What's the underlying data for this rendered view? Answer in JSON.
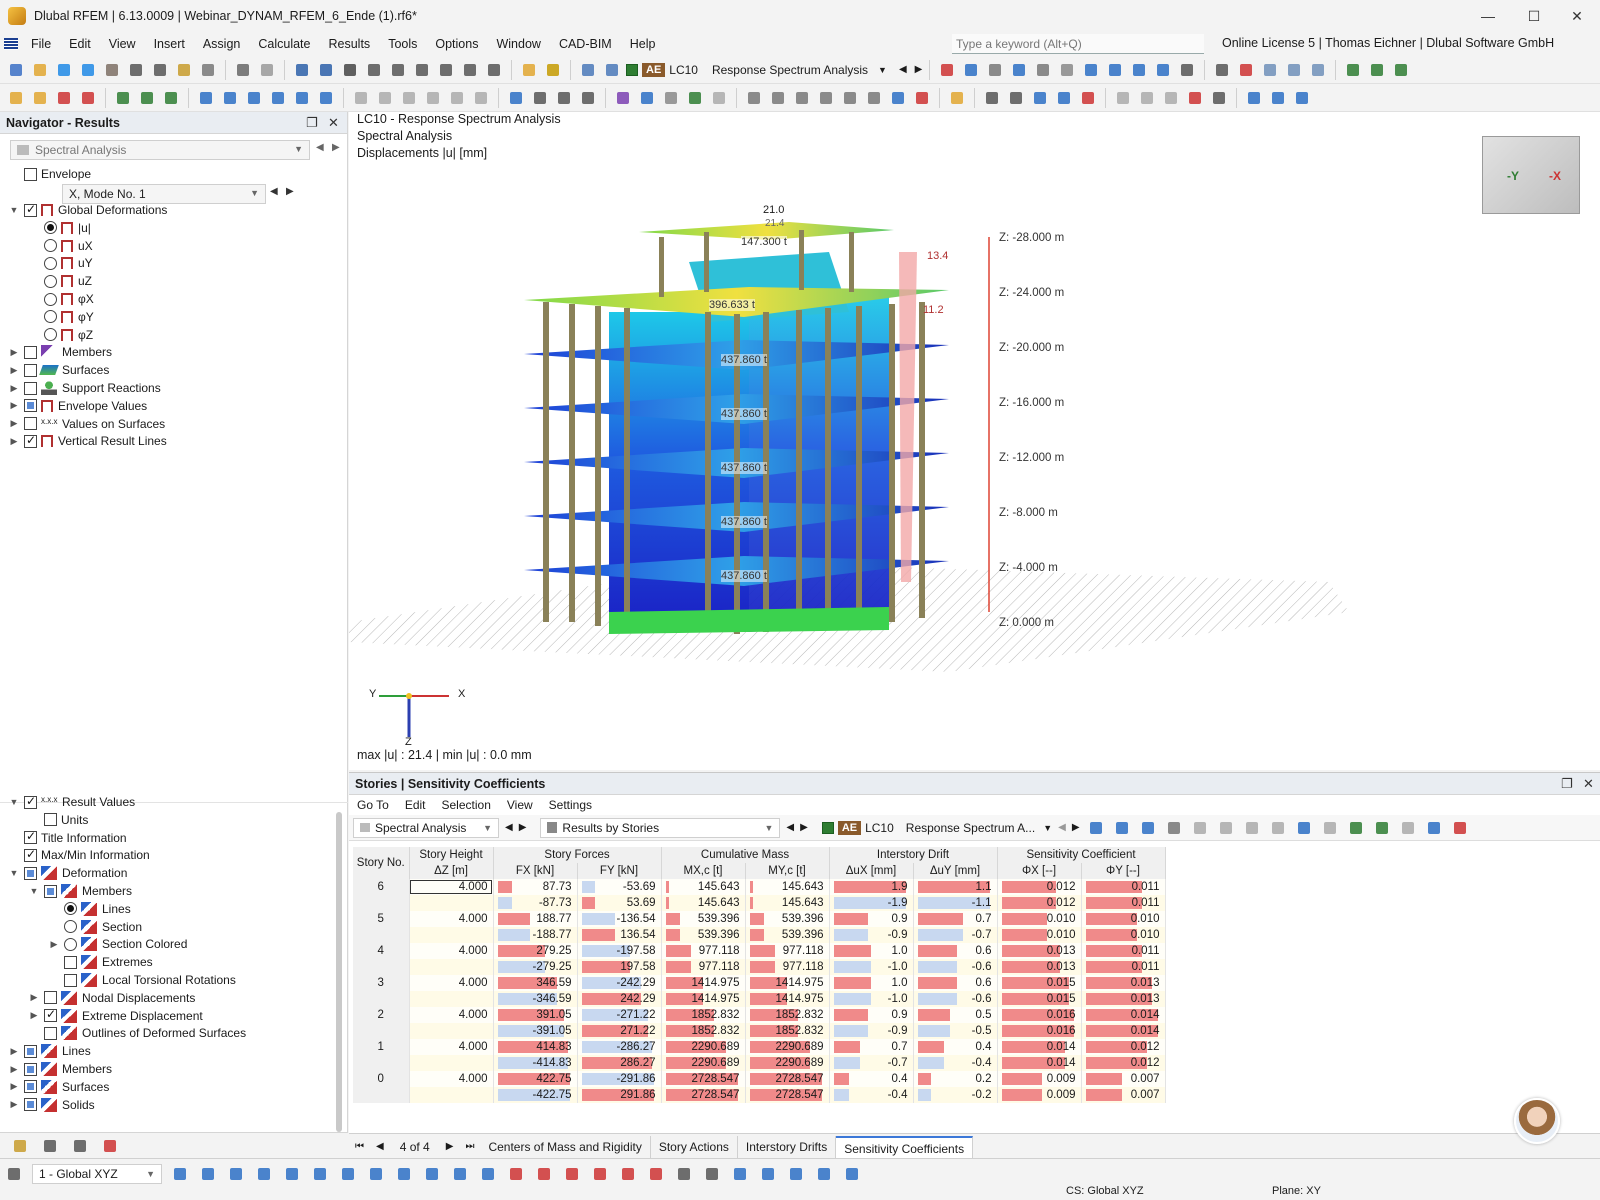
{
  "window": {
    "title": "Dlubal RFEM | 6.13.0009 | Webinar_DYNAM_RFEM_6_Ende (1).rf6*",
    "minimize": "—",
    "maximize": "☐",
    "close": "✕"
  },
  "menu": {
    "items": [
      "File",
      "Edit",
      "View",
      "Insert",
      "Assign",
      "Calculate",
      "Results",
      "Tools",
      "Options",
      "Window",
      "CAD-BIM",
      "Help"
    ],
    "search_placeholder": "Type a keyword (Alt+Q)",
    "license": "Online License 5 | Thomas Eichner | Dlubal Software GmbH"
  },
  "toolbar": {
    "ae": "AE",
    "lc": "LC10",
    "lc_name": "Response Spectrum Analysis"
  },
  "navigator": {
    "title": "Navigator - Results",
    "dropdown": "Spectral Analysis",
    "envelope": "Envelope",
    "mode": "X, Mode No. 1",
    "tree": [
      {
        "label": "Global Deformations",
        "level": 0,
        "exp": "v",
        "ctrl": "chk-on",
        "icon": "defo"
      },
      {
        "label": "|u|",
        "level": 1,
        "ctrl": "radio-on",
        "icon": "defo"
      },
      {
        "label": "uX",
        "level": 1,
        "ctrl": "radio",
        "icon": "defo"
      },
      {
        "label": "uY",
        "level": 1,
        "ctrl": "radio",
        "icon": "defo"
      },
      {
        "label": "uZ",
        "level": 1,
        "ctrl": "radio",
        "icon": "defo"
      },
      {
        "label": "φX",
        "level": 1,
        "ctrl": "radio",
        "icon": "defo"
      },
      {
        "label": "φY",
        "level": 1,
        "ctrl": "radio",
        "icon": "defo"
      },
      {
        "label": "φZ",
        "level": 1,
        "ctrl": "radio",
        "icon": "defo"
      },
      {
        "label": "Members",
        "level": 0,
        "exp": ">",
        "ctrl": "chk",
        "icon": "member"
      },
      {
        "label": "Surfaces",
        "level": 0,
        "exp": ">",
        "ctrl": "chk",
        "icon": "surf"
      },
      {
        "label": "Support Reactions",
        "level": 0,
        "exp": ">",
        "ctrl": "chk",
        "icon": "support"
      },
      {
        "label": "Envelope Values",
        "level": 0,
        "exp": ">",
        "ctrl": "chk-partial",
        "icon": "defo"
      },
      {
        "label": "Values on Surfaces",
        "level": 0,
        "exp": ">",
        "ctrl": "chk",
        "icon": "xxx"
      },
      {
        "label": "Vertical Result Lines",
        "level": 0,
        "exp": ">",
        "ctrl": "chk-on",
        "icon": "defo"
      }
    ],
    "tree2": [
      {
        "label": "Result Values",
        "level": 0,
        "exp": "v",
        "ctrl": "chk-on",
        "icon": "xxx"
      },
      {
        "label": "Units",
        "level": 1,
        "ctrl": "chk",
        "icon": ""
      },
      {
        "label": "Title Information",
        "level": 0,
        "ctrl": "chk-on",
        "icon": ""
      },
      {
        "label": "Max/Min Information",
        "level": 0,
        "ctrl": "chk-on",
        "icon": ""
      },
      {
        "label": "Deformation",
        "level": 0,
        "exp": "v",
        "ctrl": "chk-partial",
        "icon": "blue"
      },
      {
        "label": "Members",
        "level": 1,
        "exp": "v",
        "ctrl": "chk-partial",
        "icon": "blue"
      },
      {
        "label": "Lines",
        "level": 2,
        "ctrl": "radio-on",
        "icon": "blue"
      },
      {
        "label": "Section",
        "level": 2,
        "ctrl": "radio",
        "icon": "blue"
      },
      {
        "label": "Section Colored",
        "level": 2,
        "exp": ">",
        "ctrl": "radio",
        "icon": "blue"
      },
      {
        "label": "Extremes",
        "level": 2,
        "ctrl": "chk",
        "icon": "blue"
      },
      {
        "label": "Local Torsional Rotations",
        "level": 2,
        "ctrl": "chk",
        "icon": "blue"
      },
      {
        "label": "Nodal Displacements",
        "level": 1,
        "exp": ">",
        "ctrl": "chk",
        "icon": "blue"
      },
      {
        "label": "Extreme Displacement",
        "level": 1,
        "exp": ">",
        "ctrl": "chk-on",
        "icon": "blue"
      },
      {
        "label": "Outlines of Deformed Surfaces",
        "level": 1,
        "ctrl": "chk",
        "icon": "blue"
      },
      {
        "label": "Lines",
        "level": 0,
        "exp": ">",
        "ctrl": "chk-partial",
        "icon": "blue"
      },
      {
        "label": "Members",
        "level": 0,
        "exp": ">",
        "ctrl": "chk-partial",
        "icon": "blue"
      },
      {
        "label": "Surfaces",
        "level": 0,
        "exp": ">",
        "ctrl": "chk-partial",
        "icon": "blue"
      },
      {
        "label": "Solids",
        "level": 0,
        "exp": ">",
        "ctrl": "chk-partial",
        "icon": "blue"
      }
    ]
  },
  "viewport": {
    "line1": "LC10 - Response Spectrum Analysis",
    "line2": "Spectral Analysis",
    "line3": "Displacements |u| [mm]",
    "maxmin": "max |u| : 21.4 | min |u| : 0.0 mm",
    "z_levels": [
      "Z: -28.000 m",
      "Z: -24.000 m",
      "Z: -20.000 m",
      "Z: -16.000 m",
      "Z: -12.000 m",
      "Z: -8.000 m",
      "Z: -4.000 m",
      "Z: 0.000 m"
    ],
    "labels": {
      "top": "21.0",
      "top2": "21.4",
      "mass_top": "147.300 t",
      "mass2": "396.633 t",
      "mass_floor": "437.860 t",
      "drift_a": "13.4",
      "drift_b": "11.2"
    },
    "axis": {
      "x": "X",
      "y": "Y",
      "z": "Z"
    },
    "cube": {
      "left": "-Y",
      "right": "-X"
    }
  },
  "table": {
    "title": "Stories | Sensitivity Coefficients",
    "menus": [
      "Go To",
      "Edit",
      "Selection",
      "View",
      "Settings"
    ],
    "dd1": "Spectral Analysis",
    "dd2": "Results by Stories",
    "ae": "AE",
    "lc": "LC10",
    "lc_name": "Response Spectrum A...",
    "group_headers": [
      "Story No.",
      "Story Height",
      "Story Forces",
      "Cumulative Mass",
      "Interstory Drift",
      "Sensitivity Coefficient"
    ],
    "col_headers": [
      "ΔZ [m]",
      "FX [kN]",
      "FY [kN]",
      "MX,c [t]",
      "MY,c [t]",
      "ΔuX [mm]",
      "ΔuY [mm]",
      "ΦX [--]",
      "ΦY [--]"
    ],
    "rows": [
      {
        "story": "6",
        "h": "4.000",
        "fx": "87.73",
        "fy": "-53.69",
        "mx": "145.643",
        "my": "145.643",
        "dux": "1.9",
        "duy": "1.1",
        "phx": "0.012",
        "phy": "0.011"
      },
      {
        "story": "",
        "h": "",
        "fx": "-87.73",
        "fy": "53.69",
        "mx": "145.643",
        "my": "145.643",
        "dux": "-1.9",
        "duy": "-1.1",
        "phx": "0.012",
        "phy": "0.011"
      },
      {
        "story": "5",
        "h": "4.000",
        "fx": "188.77",
        "fy": "-136.54",
        "mx": "539.396",
        "my": "539.396",
        "dux": "0.9",
        "duy": "0.7",
        "phx": "0.010",
        "phy": "0.010"
      },
      {
        "story": "",
        "h": "",
        "fx": "-188.77",
        "fy": "136.54",
        "mx": "539.396",
        "my": "539.396",
        "dux": "-0.9",
        "duy": "-0.7",
        "phx": "0.010",
        "phy": "0.010"
      },
      {
        "story": "4",
        "h": "4.000",
        "fx": "279.25",
        "fy": "-197.58",
        "mx": "977.118",
        "my": "977.118",
        "dux": "1.0",
        "duy": "0.6",
        "phx": "0.013",
        "phy": "0.011"
      },
      {
        "story": "",
        "h": "",
        "fx": "-279.25",
        "fy": "197.58",
        "mx": "977.118",
        "my": "977.118",
        "dux": "-1.0",
        "duy": "-0.6",
        "phx": "0.013",
        "phy": "0.011"
      },
      {
        "story": "3",
        "h": "4.000",
        "fx": "346.59",
        "fy": "-242.29",
        "mx": "1414.975",
        "my": "1414.975",
        "dux": "1.0",
        "duy": "0.6",
        "phx": "0.015",
        "phy": "0.013"
      },
      {
        "story": "",
        "h": "",
        "fx": "-346.59",
        "fy": "242.29",
        "mx": "1414.975",
        "my": "1414.975",
        "dux": "-1.0",
        "duy": "-0.6",
        "phx": "0.015",
        "phy": "0.013"
      },
      {
        "story": "2",
        "h": "4.000",
        "fx": "391.05",
        "fy": "-271.22",
        "mx": "1852.832",
        "my": "1852.832",
        "dux": "0.9",
        "duy": "0.5",
        "phx": "0.016",
        "phy": "0.014"
      },
      {
        "story": "",
        "h": "",
        "fx": "-391.05",
        "fy": "271.22",
        "mx": "1852.832",
        "my": "1852.832",
        "dux": "-0.9",
        "duy": "-0.5",
        "phx": "0.016",
        "phy": "0.014"
      },
      {
        "story": "1",
        "h": "4.000",
        "fx": "414.83",
        "fy": "-286.27",
        "mx": "2290.689",
        "my": "2290.689",
        "dux": "0.7",
        "duy": "0.4",
        "phx": "0.014",
        "phy": "0.012"
      },
      {
        "story": "",
        "h": "",
        "fx": "-414.83",
        "fy": "286.27",
        "mx": "2290.689",
        "my": "2290.689",
        "dux": "-0.7",
        "duy": "-0.4",
        "phx": "0.014",
        "phy": "0.012"
      },
      {
        "story": "0",
        "h": "4.000",
        "fx": "422.75",
        "fy": "-291.86",
        "mx": "2728.547",
        "my": "2728.547",
        "dux": "0.4",
        "duy": "0.2",
        "phx": "0.009",
        "phy": "0.007"
      },
      {
        "story": "",
        "h": "",
        "fx": "-422.75",
        "fy": "291.86",
        "mx": "2728.547",
        "my": "2728.547",
        "dux": "-0.4",
        "duy": "-0.2",
        "phx": "0.009",
        "phy": "0.007"
      }
    ],
    "pager": "4 of 4",
    "tabs": [
      "Centers of Mass and Rigidity",
      "Story Actions",
      "Interstory Drifts",
      "Sensitivity Coefficients"
    ],
    "active_tab": 3
  },
  "status": {
    "view": "1 - Global XYZ",
    "cs": "CS: Global XYZ",
    "plane": "Plane: XY"
  },
  "colors": {
    "accent": "#3c78d8",
    "bar_red": "#f08a8a",
    "bar_blue": "#c8d8f0"
  }
}
